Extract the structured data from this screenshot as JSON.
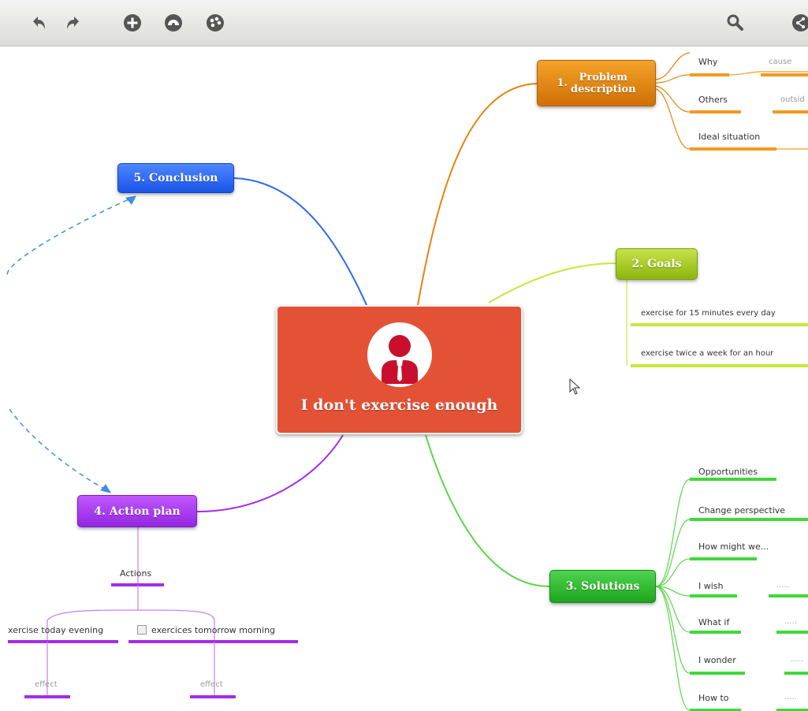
{
  "toolbar": {
    "left_icons": [
      "undo-icon",
      "redo-icon",
      "add-node-icon",
      "palette-icon",
      "theme-icon"
    ],
    "right_icons": [
      "search-icon",
      "share-icon"
    ]
  },
  "center": {
    "title": "I don't exercise enough",
    "icon": "user-avatar-icon"
  },
  "branches": {
    "problem": {
      "number": "1.",
      "label": "Problem\ndescription",
      "color": "#e38411",
      "children": [
        {
          "label": "Why",
          "note": "cause"
        },
        {
          "label": "Others",
          "note": "outsid"
        },
        {
          "label": "Ideal situation",
          "note": ""
        }
      ]
    },
    "goals": {
      "label": "2. Goals",
      "color": "#a9d31b",
      "children": [
        {
          "label": "exercise for 15 minutes every day"
        },
        {
          "label": "exercise twice a week for an hour"
        }
      ]
    },
    "solutions": {
      "label": "3. Solutions",
      "color": "#33cc2f",
      "children": [
        {
          "label": "Opportunities",
          "note": ""
        },
        {
          "label": "Change perspective",
          "note": ""
        },
        {
          "label": "How might we...",
          "note": ""
        },
        {
          "label": "I wish",
          "note": "....."
        },
        {
          "label": "What if",
          "note": "....."
        },
        {
          "label": "I wonder",
          "note": "....."
        },
        {
          "label": "How to",
          "note": "....."
        }
      ]
    },
    "action": {
      "label": "4. Action plan",
      "color": "#a52ce8",
      "actions_label": "Actions",
      "children": [
        {
          "label": "xercise today evening",
          "effect": "effect"
        },
        {
          "label": "exercices tomorrow morning",
          "effect": "effect"
        }
      ]
    },
    "conclusion": {
      "label": "5. Conclusion",
      "color": "#2d69f2"
    }
  }
}
